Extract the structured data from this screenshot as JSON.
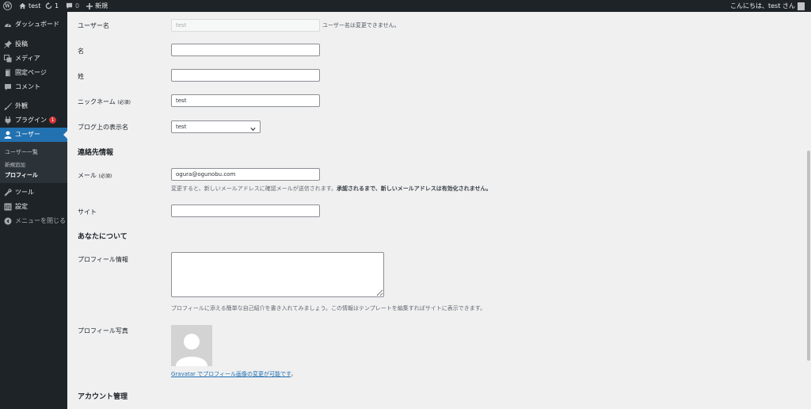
{
  "adminbar": {
    "site_name": "test",
    "updates_count": "1",
    "comments_count": "0",
    "new_label": "新規",
    "greeting": "こんにちは、test さん"
  },
  "sidebar": {
    "items": [
      {
        "label": "ダッシュボード",
        "icon": "dashboard-icon"
      },
      {
        "label": "投稿",
        "icon": "pushpin-icon"
      },
      {
        "label": "メディア",
        "icon": "media-icon"
      },
      {
        "label": "固定ページ",
        "icon": "page-icon"
      },
      {
        "label": "コメント",
        "icon": "comment-icon"
      },
      {
        "label": "外観",
        "icon": "brush-icon"
      },
      {
        "label": "プラグイン",
        "icon": "plugin-icon",
        "badge": "1"
      },
      {
        "label": "ユーザー",
        "icon": "user-icon"
      },
      {
        "label": "ツール",
        "icon": "wrench-icon"
      },
      {
        "label": "設定",
        "icon": "settings-icon"
      },
      {
        "label": "メニューを閉じる",
        "icon": "collapse-icon"
      }
    ],
    "submenu": [
      "ユーザー一覧",
      "新規追加",
      "プロフィール"
    ]
  },
  "form": {
    "username_label": "ユーザー名",
    "username_value": "test",
    "username_note": "ユーザー名は変更できません。",
    "first_name_label": "名",
    "first_name_value": "",
    "last_name_label": "姓",
    "last_name_value": "",
    "nickname_label": "ニックネーム",
    "nickname_required": "(必須)",
    "nickname_value": "test",
    "display_name_label": "ブログ上の表示名",
    "display_name_value": "test",
    "contact_heading": "連絡先情報",
    "email_label": "メール",
    "email_required": "(必須)",
    "email_value": "ogura@ogunobu.com",
    "email_note": "変更すると、新しいメールアドレスに確認メールが送信されます。",
    "email_note_bold": "承認されるまで、新しいメールアドレスは有効化されません。",
    "site_label": "サイト",
    "site_value": "",
    "about_heading": "あなたについて",
    "bio_label": "プロフィール情報",
    "bio_value": "",
    "bio_note": "プロフィールに添える簡単な自己紹介を書き入れてみましょう。この情報はテンプレートを編集すればサイトに表示できます。",
    "avatar_label": "プロフィール写真",
    "gravatar_link": "Gravatar でプロフィール画像の変更が可能です",
    "gravatar_suffix": "。",
    "account_heading": "アカウント管理"
  },
  "colors": {
    "sidebar_bg": "#1d2327",
    "accent": "#2271b1",
    "badge": "#d63638",
    "page_bg": "#f0f0f1"
  }
}
